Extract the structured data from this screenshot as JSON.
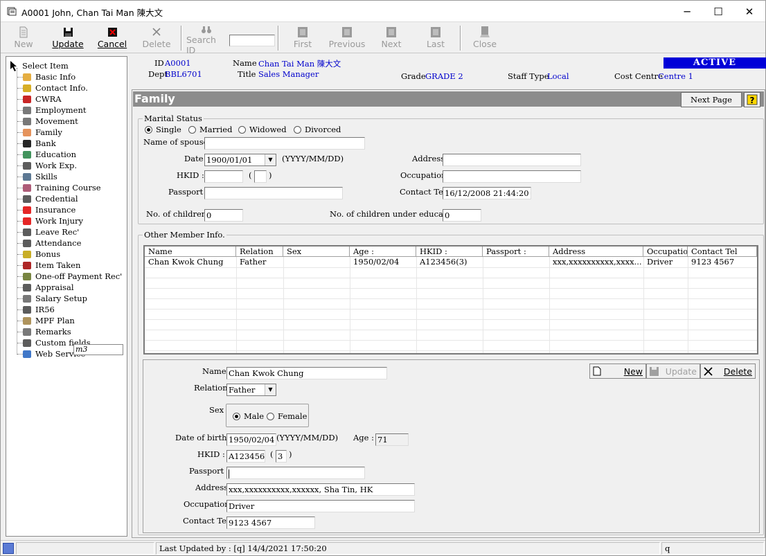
{
  "window": {
    "title": "A0001 John, Chan Tai Man 陳大文",
    "minimize": "─",
    "maximize": "☐",
    "close": "✕"
  },
  "toolbar": {
    "new": "New",
    "update": "Update",
    "cancel": "Cancel",
    "delete": "Delete",
    "search_id": "Search ID",
    "first": "First",
    "previous": "Previous",
    "next": "Next",
    "last": "Last",
    "close": "Close"
  },
  "sidebar": {
    "root": "Select Item",
    "items": [
      {
        "label": "Basic Info",
        "icon": "person-icon"
      },
      {
        "label": "Contact Info.",
        "icon": "envelope-icon"
      },
      {
        "label": "CWRA",
        "icon": "book-icon"
      },
      {
        "label": "Employment",
        "icon": "letter-icon"
      },
      {
        "label": "Movement",
        "icon": "move-icon"
      },
      {
        "label": "Family",
        "icon": "family-icon"
      },
      {
        "label": "Bank",
        "icon": "bank-icon"
      },
      {
        "label": "Education",
        "icon": "globe-book-icon"
      },
      {
        "label": "Work Exp.",
        "icon": "document-icon"
      },
      {
        "label": "Skills",
        "icon": "magnifier-icon"
      },
      {
        "label": "Training Course",
        "icon": "training-icon"
      },
      {
        "label": "Credential",
        "icon": "credential-icon"
      },
      {
        "label": "Insurance",
        "icon": "heart-icon"
      },
      {
        "label": "Work Injury",
        "icon": "red-cross-icon"
      },
      {
        "label": "Leave Rec'",
        "icon": "calendar-icon"
      },
      {
        "label": "Attendance",
        "icon": "clock-icon"
      },
      {
        "label": "Bonus",
        "icon": "coins-icon"
      },
      {
        "label": "Item Taken",
        "icon": "item-icon"
      },
      {
        "label": "One-off Payment Rec'",
        "icon": "dollar-icon"
      },
      {
        "label": "Appraisal",
        "icon": "checklist-icon"
      },
      {
        "label": "Salary Setup",
        "icon": "salary-icon"
      },
      {
        "label": "IR56",
        "icon": "ir56-icon"
      },
      {
        "label": "MPF Plan",
        "icon": "mpf-icon"
      },
      {
        "label": "Remarks",
        "icon": "paperclip-icon"
      },
      {
        "label": "Custom fields",
        "icon": "custom-fields-icon"
      },
      {
        "label": "Web Service",
        "icon": "globe-icon"
      }
    ],
    "tooltip": "m3"
  },
  "header": {
    "id_label": "ID",
    "id_value": "A0001",
    "dept_label": "Dept",
    "dept_value": "BBL6701",
    "name_label": "Name",
    "name_value": "Chan Tai Man 陳大文",
    "title_label": "Title",
    "title_value": "Sales Manager",
    "grade_label": "Grade",
    "grade_value": "GRADE 2",
    "staff_type_label": "Staff Type",
    "staff_type_value": "Local",
    "cost_centre_label": "Cost Centre",
    "cost_centre_value": "Centre 1",
    "status": "ACTIVE",
    "status_color": "#0000d8"
  },
  "section": {
    "title": "Family",
    "next_page": "Next Page",
    "help": "?"
  },
  "marital": {
    "group_label": "Marital Status",
    "options": [
      "Single",
      "Married",
      "Widowed",
      "Divorced"
    ],
    "selected": "Single",
    "spouse_label": "Name of spouse :",
    "spouse_value": "",
    "date_label": "Date",
    "date_value": "1900/01/01",
    "date_format": "(YYYY/MM/DD)",
    "hkid_label": "HKID :",
    "hkid_value": "",
    "hkid_check": "",
    "hkid_open": "(",
    "hkid_close": ")",
    "passport_label": "Passport :",
    "passport_value": "",
    "address_label": "Address",
    "address_value": "",
    "occupation_label": "Occupation",
    "occupation_value": "",
    "contact_label": "Contact Tel",
    "contact_value": "16/12/2008 21:44:20",
    "children_label": "No. of children :",
    "children_value": "0",
    "children_edu_label": "No. of children under education :",
    "children_edu_value": "0"
  },
  "members": {
    "group_label": "Other Member Info.",
    "columns": [
      "Name",
      "Relation",
      "Sex",
      "Age :",
      "HKID :",
      "Passport :",
      "Address",
      "Occupation",
      "Contact Tel"
    ],
    "rows": [
      [
        "Chan Kwok Chung",
        "Father",
        "",
        "1950/02/04",
        "A123456(3)",
        "",
        "xxx,xxxxxxxxxx,xxxx...",
        "Driver",
        "9123 4567"
      ]
    ]
  },
  "detail": {
    "name_label": "Name",
    "name_value": "Chan Kwok Chung",
    "relation_label": "Relation",
    "relation_value": "Father",
    "sex_label": "Sex",
    "sex_options": [
      "Male",
      "Female"
    ],
    "sex_selected": "Male",
    "dob_label": "Date of birth :",
    "dob_value": "1950/02/04",
    "dob_format": "(YYYY/MM/DD)",
    "age_label": "Age :",
    "age_value": "71",
    "hkid_label": "HKID :",
    "hkid_value": "A123456",
    "hkid_check": "3",
    "hkid_open": "(",
    "hkid_close": ")",
    "passport_label": "Passport :",
    "passport_value": "",
    "address_label": "Address",
    "address_value": "xxx,xxxxxxxxxx,xxxxxx, Sha Tin, HK",
    "occupation_label": "Occupation",
    "occupation_value": "Driver",
    "contact_label": "Contact Tel",
    "contact_value": "9123 4567",
    "btn_new": "New",
    "btn_update": "Update",
    "btn_delete": "Delete"
  },
  "statusbar": {
    "updated": "Last Updated by : [q]  14/4/2021 17:50:20",
    "user": "q"
  }
}
